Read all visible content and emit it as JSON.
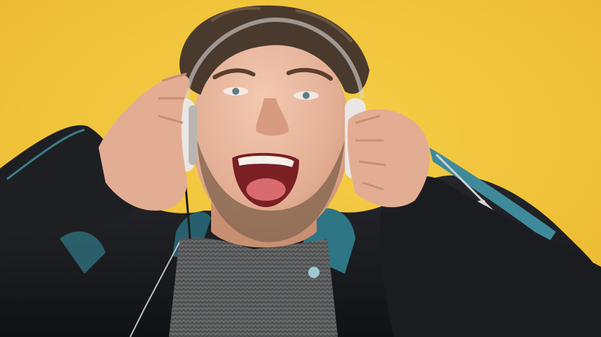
{
  "colors": {
    "background": "#f3c63a",
    "background_shadow": "#e8b52c",
    "skin": "#e6b59a",
    "skin_shadow": "#c98f72",
    "hair": "#4a3a2e",
    "beard": "#8a6a52",
    "jacket": "#1b1c20",
    "jacket_highlight": "#3f8a9a",
    "sweater": "#5e5f60",
    "headphones": "#e9e6e4",
    "mouth": "#7a2024",
    "teeth": "#f4f1ea",
    "zipper": "#c8c8c8"
  },
  "scene": {
    "subject": "man-singing-with-headphones"
  }
}
